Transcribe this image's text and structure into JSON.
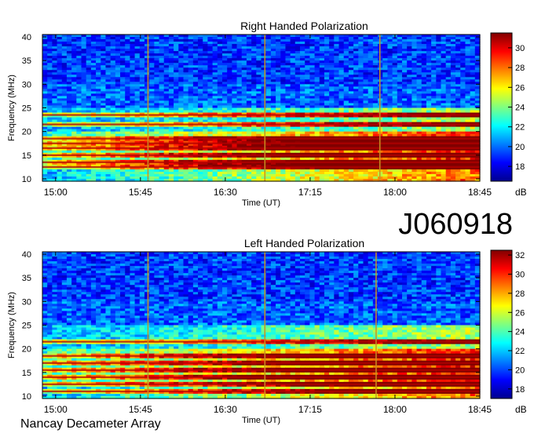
{
  "figure_label": "J060918",
  "footer": "Nancay Decameter Array",
  "chart_data": [
    {
      "type": "heatmap",
      "title": "Right Handed Polarization",
      "xlabel": "Time (UT)",
      "ylabel": "Frequency (MHz)",
      "x_ticks": [
        "15:00",
        "15:45",
        "16:30",
        "17:15",
        "18:00",
        "18:45"
      ],
      "y_ticks": [
        10,
        15,
        20,
        25,
        30,
        35,
        40
      ],
      "y_range": [
        9.5,
        40.5
      ],
      "colorbar_label": "dB",
      "colorbar_ticks": [
        18,
        20,
        22,
        24,
        26,
        28,
        30
      ],
      "colorbar_range": [
        16.5,
        31.5
      ],
      "colormap": "jet",
      "x_range": [
        "14:53",
        "18:45"
      ],
      "vertical_lines_at": [
        "15:49",
        "16:51",
        "17:52"
      ],
      "horizontal_bands_mhz": [
        12.5,
        13.5,
        15.0,
        16.5,
        17.5,
        18.5,
        21.5,
        23.5
      ]
    },
    {
      "type": "heatmap",
      "title": "Left Handed Polarization",
      "xlabel": "Time (UT)",
      "ylabel": "Frequency (MHz)",
      "x_ticks": [
        "15:00",
        "15:45",
        "16:30",
        "17:15",
        "18:00",
        "18:45"
      ],
      "y_ticks": [
        10,
        15,
        20,
        25,
        30,
        35,
        40
      ],
      "y_range": [
        9.5,
        40.5
      ],
      "colorbar_label": "dB",
      "colorbar_ticks": [
        18,
        20,
        22,
        24,
        26,
        28,
        30,
        32
      ],
      "colorbar_range": [
        17.0,
        32.5
      ],
      "colormap": "jet",
      "x_range": [
        "14:53",
        "18:45"
      ],
      "vertical_lines_at": [
        "15:49",
        "16:51",
        "17:50"
      ],
      "horizontal_bands_mhz": [
        11.0,
        12.5,
        14.0,
        15.5,
        17.0,
        18.5,
        21.5
      ]
    }
  ],
  "colors": {
    "jet_stops": [
      "#00008f",
      "#0000ff",
      "#00ffff",
      "#ffff00",
      "#ff0000",
      "#800000"
    ]
  }
}
